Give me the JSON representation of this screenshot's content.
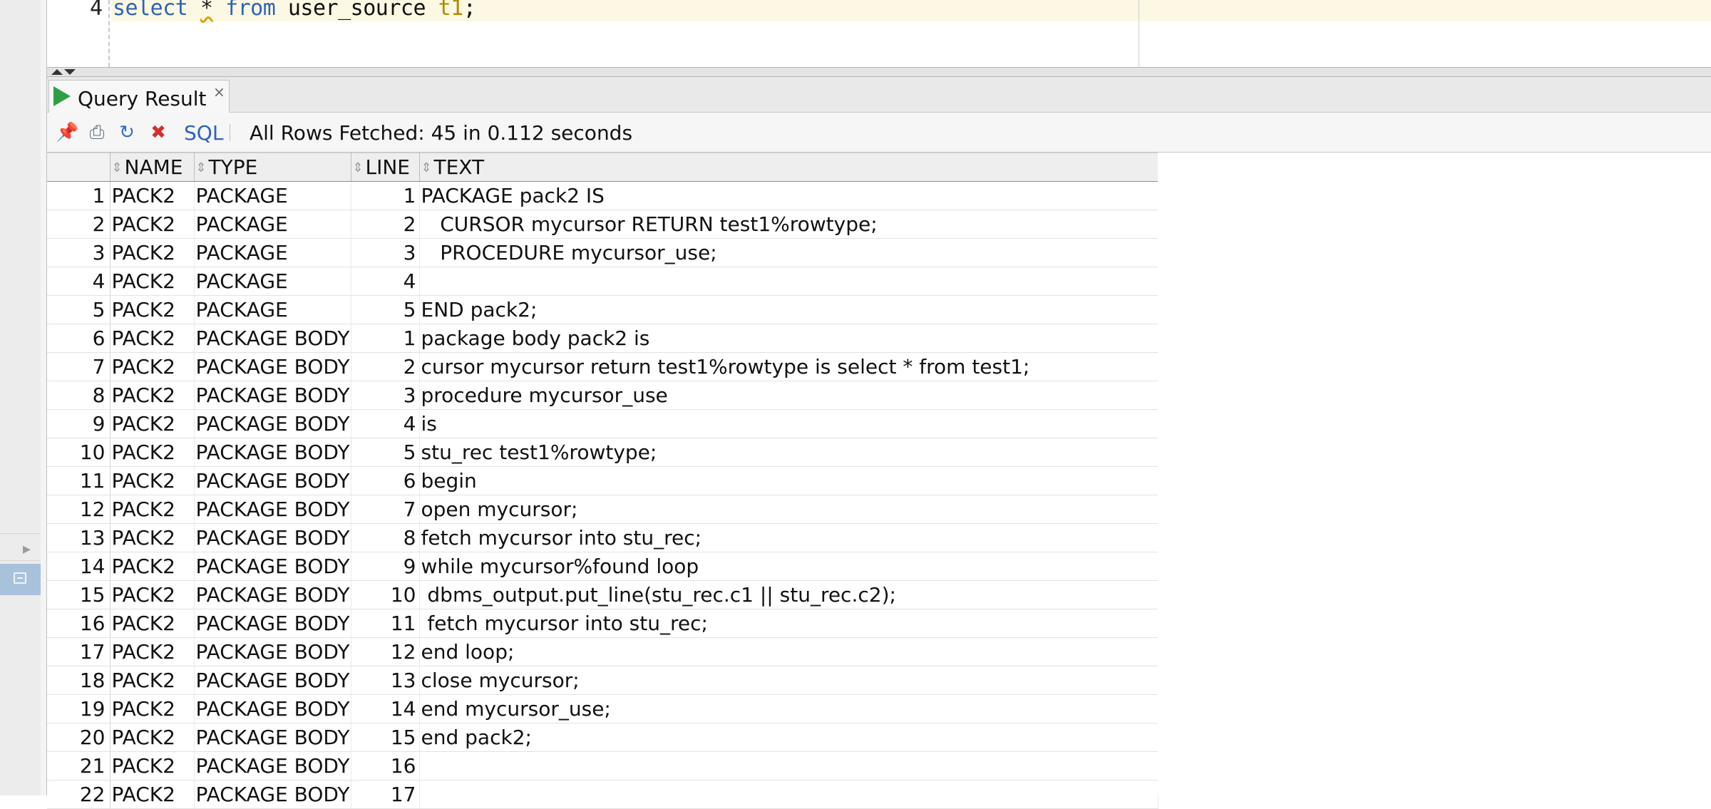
{
  "editor": {
    "line_number": "4",
    "code_tokens": [
      {
        "text": "select",
        "kind": "kw"
      },
      {
        "text": " ",
        "kind": "plain"
      },
      {
        "text": "*",
        "kind": "star"
      },
      {
        "text": " ",
        "kind": "plain"
      },
      {
        "text": "from",
        "kind": "kw"
      },
      {
        "text": " user_source ",
        "kind": "plain"
      },
      {
        "text": "t1",
        "kind": "alias"
      },
      {
        "text": ";",
        "kind": "plain"
      }
    ]
  },
  "result_tab": {
    "label": "Query Result",
    "close_glyph": "×"
  },
  "toolbar": {
    "icons": [
      "pin-icon",
      "print-icon",
      "refresh-icon",
      "cancel-icon"
    ],
    "sql_label": "SQL",
    "status": "All Rows Fetched: 45 in 0.112 seconds"
  },
  "grid": {
    "columns": [
      "NAME",
      "TYPE",
      "LINE",
      "TEXT"
    ],
    "rows": [
      {
        "n": "1",
        "name": "PACK2",
        "type": "PACKAGE",
        "line": "1",
        "text": "PACKAGE pack2 IS"
      },
      {
        "n": "2",
        "name": "PACK2",
        "type": "PACKAGE",
        "line": "2",
        "text": "   CURSOR mycursor RETURN test1%rowtype;"
      },
      {
        "n": "3",
        "name": "PACK2",
        "type": "PACKAGE",
        "line": "3",
        "text": "   PROCEDURE mycursor_use;"
      },
      {
        "n": "4",
        "name": "PACK2",
        "type": "PACKAGE",
        "line": "4",
        "text": ""
      },
      {
        "n": "5",
        "name": "PACK2",
        "type": "PACKAGE",
        "line": "5",
        "text": "END pack2;"
      },
      {
        "n": "6",
        "name": "PACK2",
        "type": "PACKAGE BODY",
        "line": "1",
        "text": "package body pack2 is"
      },
      {
        "n": "7",
        "name": "PACK2",
        "type": "PACKAGE BODY",
        "line": "2",
        "text": "cursor mycursor return test1%rowtype is select * from test1;"
      },
      {
        "n": "8",
        "name": "PACK2",
        "type": "PACKAGE BODY",
        "line": "3",
        "text": "procedure mycursor_use"
      },
      {
        "n": "9",
        "name": "PACK2",
        "type": "PACKAGE BODY",
        "line": "4",
        "text": "is"
      },
      {
        "n": "10",
        "name": "PACK2",
        "type": "PACKAGE BODY",
        "line": "5",
        "text": "stu_rec test1%rowtype;"
      },
      {
        "n": "11",
        "name": "PACK2",
        "type": "PACKAGE BODY",
        "line": "6",
        "text": "begin"
      },
      {
        "n": "12",
        "name": "PACK2",
        "type": "PACKAGE BODY",
        "line": "7",
        "text": "open mycursor;"
      },
      {
        "n": "13",
        "name": "PACK2",
        "type": "PACKAGE BODY",
        "line": "8",
        "text": "fetch mycursor into stu_rec;"
      },
      {
        "n": "14",
        "name": "PACK2",
        "type": "PACKAGE BODY",
        "line": "9",
        "text": "while mycursor%found loop"
      },
      {
        "n": "15",
        "name": "PACK2",
        "type": "PACKAGE BODY",
        "line": "10",
        "text": " dbms_output.put_line(stu_rec.c1 || stu_rec.c2);"
      },
      {
        "n": "16",
        "name": "PACK2",
        "type": "PACKAGE BODY",
        "line": "11",
        "text": " fetch mycursor into stu_rec;"
      },
      {
        "n": "17",
        "name": "PACK2",
        "type": "PACKAGE BODY",
        "line": "12",
        "text": "end loop;"
      },
      {
        "n": "18",
        "name": "PACK2",
        "type": "PACKAGE BODY",
        "line": "13",
        "text": "close mycursor;"
      },
      {
        "n": "19",
        "name": "PACK2",
        "type": "PACKAGE BODY",
        "line": "14",
        "text": "end mycursor_use;"
      },
      {
        "n": "20",
        "name": "PACK2",
        "type": "PACKAGE BODY",
        "line": "15",
        "text": "end pack2;"
      },
      {
        "n": "21",
        "name": "PACK2",
        "type": "PACKAGE BODY",
        "line": "16",
        "text": ""
      },
      {
        "n": "22",
        "name": "PACK2",
        "type": "PACKAGE BODY",
        "line": "17",
        "text": ""
      }
    ]
  }
}
